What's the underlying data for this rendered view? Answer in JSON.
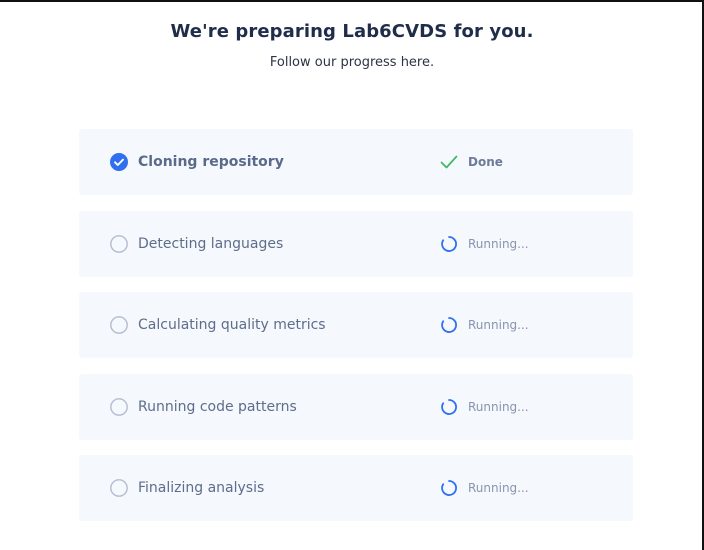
{
  "header": {
    "title": "We're preparing Lab6CVDS for you.",
    "subtitle": "Follow our progress here."
  },
  "colors": {
    "accent": "#2f6ff0",
    "done_check": "#3cb863",
    "running_spinner": "#2f6ff0",
    "step_background": "#f5f8fd"
  },
  "steps": [
    {
      "label": "Cloning repository",
      "state": "done",
      "status": "Done",
      "icon": "checked-circle-icon",
      "status_icon": "checkmark-icon"
    },
    {
      "label": "Detecting languages",
      "state": "running",
      "status": "Running...",
      "icon": "empty-circle-icon",
      "status_icon": "spinner-icon"
    },
    {
      "label": "Calculating quality metrics",
      "state": "running",
      "status": "Running...",
      "icon": "empty-circle-icon",
      "status_icon": "spinner-icon"
    },
    {
      "label": "Running code patterns",
      "state": "running",
      "status": "Running...",
      "icon": "empty-circle-icon",
      "status_icon": "spinner-icon"
    },
    {
      "label": "Finalizing analysis",
      "state": "running",
      "status": "Running...",
      "icon": "empty-circle-icon",
      "status_icon": "spinner-icon"
    }
  ]
}
